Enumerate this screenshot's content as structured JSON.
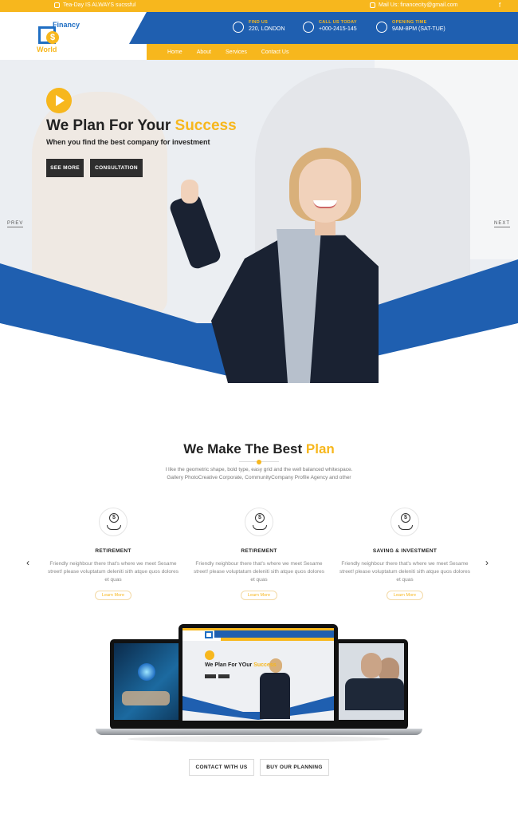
{
  "topbar": {
    "left_text": "Tea-Day IS ALWAYS sucssful",
    "right_text": "Mail Us: financecity@gmail.com",
    "social": "f"
  },
  "brand": {
    "line1": "Financy",
    "line2": "World",
    "coin": "$"
  },
  "header_info": [
    {
      "label": "FIND US",
      "value": "220, LONDON",
      "icon": "map-pin-icon"
    },
    {
      "label": "CALL US TODAY",
      "value": "+000-2415-145",
      "icon": "phone-icon"
    },
    {
      "label": "OPENING TIME",
      "value": "9AM-8PM (SAT-TUE)",
      "icon": "clock-icon"
    }
  ],
  "nav": [
    "Home",
    "About",
    "Services",
    "Contact Us"
  ],
  "hero": {
    "title_pre": "We Plan For Your ",
    "title_highlight": "Success",
    "subtitle": "When you find the best company for investment",
    "btn_primary": "SEE MORE",
    "btn_secondary": "CONSULTATION",
    "prev": "PREV",
    "next": "NEXT"
  },
  "section": {
    "title_pre": "We Make The Best ",
    "title_highlight": "Plan",
    "description": "I like the geometric shape, bold type, easy grid and the well balanced whitespace. Gallery PhotoCreative Corporate, CommunityCompany Profile Agency and other"
  },
  "features": [
    {
      "title": "RETIREMENT",
      "text": "Friendly neighbour there that's where we meet Sesame street! please voluptatum deleniti sith atque quos dolores et quas",
      "button": "Learn More",
      "icon": "money-hand-icon"
    },
    {
      "title": "RETIREMENT",
      "text": "Friendly neighbour there that's where we meet Sesame street! please voluptatum deleniti sith atque quos dolores et quas",
      "button": "Learn More",
      "icon": "money-hand-icon"
    },
    {
      "title": "SAVING & INVESTMENT",
      "text": "Friendly neighbour there that's where we meet Sesame street! please voluptatum deleniti sith atque quos dolores et quas",
      "button": "Learn More",
      "icon": "money-hand-icon"
    }
  ],
  "mockup": {
    "title_pre": "We Plan For YOur ",
    "title_highlight": "Success"
  },
  "bottom_buttons": {
    "contact": "CONTACT WITH US",
    "planning": "BUY OUR PLANNING"
  },
  "colors": {
    "accent": "#f7b71d",
    "brand_blue": "#1f5fb0",
    "dark": "#2e2e2e"
  }
}
